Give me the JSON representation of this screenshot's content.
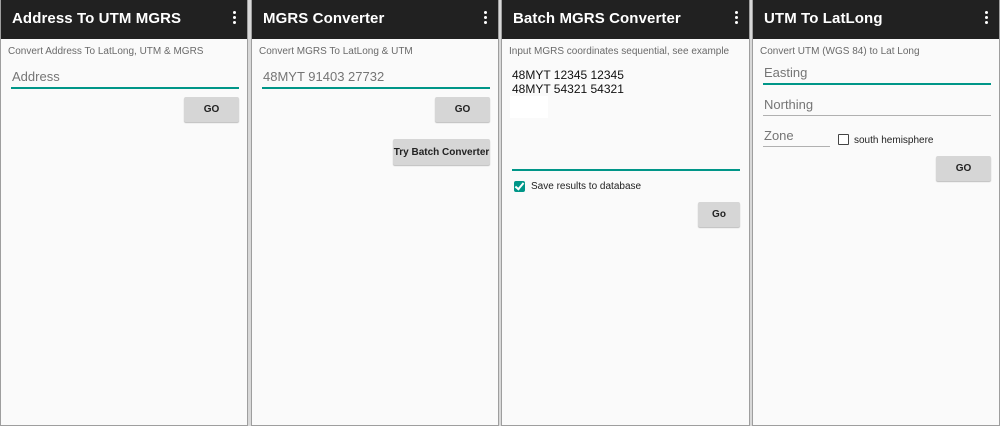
{
  "screens": [
    {
      "title": "Address To UTM MGRS",
      "caption": "Convert Address To LatLong, UTM & MGRS",
      "address_placeholder": "Address",
      "go_label": "GO"
    },
    {
      "title": "MGRS Converter",
      "caption": "Convert MGRS To LatLong & UTM",
      "mgrs_placeholder": "48MYT 91403 27732",
      "go_label": "GO",
      "batch_label": "Try Batch Converter"
    },
    {
      "title": "Batch MGRS Converter",
      "caption": "Input MGRS coordinates sequential, see example",
      "coordinates": "48MYT 12345 12345\n48MYT 54321 54321",
      "save_label": "Save results to database",
      "save_checked": true,
      "go_label": "Go"
    },
    {
      "title": "UTM To LatLong",
      "caption": "Convert UTM (WGS 84) to Lat Long",
      "easting_placeholder": "Easting",
      "northing_placeholder": "Northing",
      "zone_placeholder": "Zone",
      "south_label": "south hemisphere",
      "south_checked": false,
      "go_label": "GO"
    }
  ],
  "icons": {
    "overflow_menu": "more-vert-icon"
  },
  "colors": {
    "appbar": "#212121",
    "accent": "#009688",
    "button": "#d6d6d6",
    "background": "#fafafa"
  }
}
